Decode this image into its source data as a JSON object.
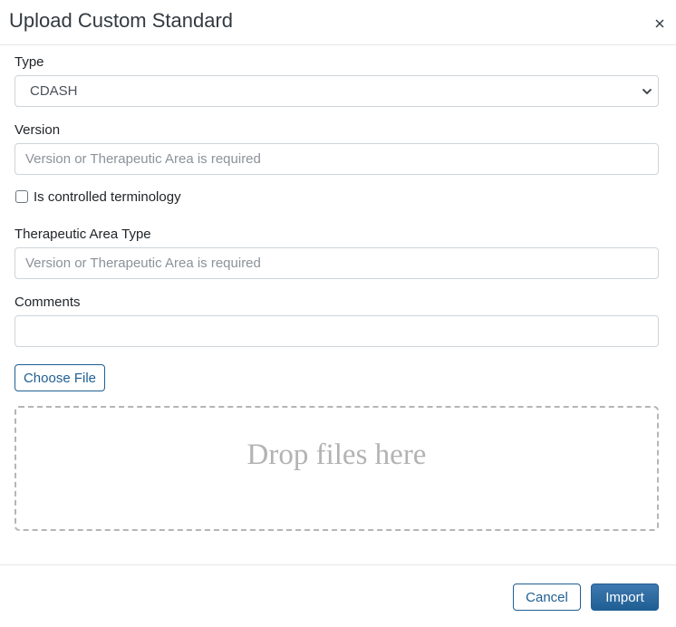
{
  "dialog": {
    "title": "Upload Custom Standard",
    "close_icon": "close-icon"
  },
  "form": {
    "type": {
      "label": "Type",
      "selected": "CDASH",
      "chevron_icon": "chevron-down-icon"
    },
    "version": {
      "label": "Version",
      "value": "",
      "placeholder": "Version or Therapeutic Area is required"
    },
    "controlled_terminology": {
      "label": "Is controlled terminology",
      "checked": false
    },
    "therapeutic_area_type": {
      "label": "Therapeutic Area Type",
      "value": "",
      "placeholder": "Version or Therapeutic Area is required"
    },
    "comments": {
      "label": "Comments",
      "value": "",
      "placeholder": ""
    },
    "choose_file_label": "Choose File",
    "dropzone_text": "Drop files here"
  },
  "footer": {
    "cancel_label": "Cancel",
    "import_label": "Import"
  },
  "colors": {
    "accent": "#1f5f94",
    "border": "#ced4da",
    "placeholder": "#8b9299",
    "dropzone_border": "#b5b5b5"
  }
}
